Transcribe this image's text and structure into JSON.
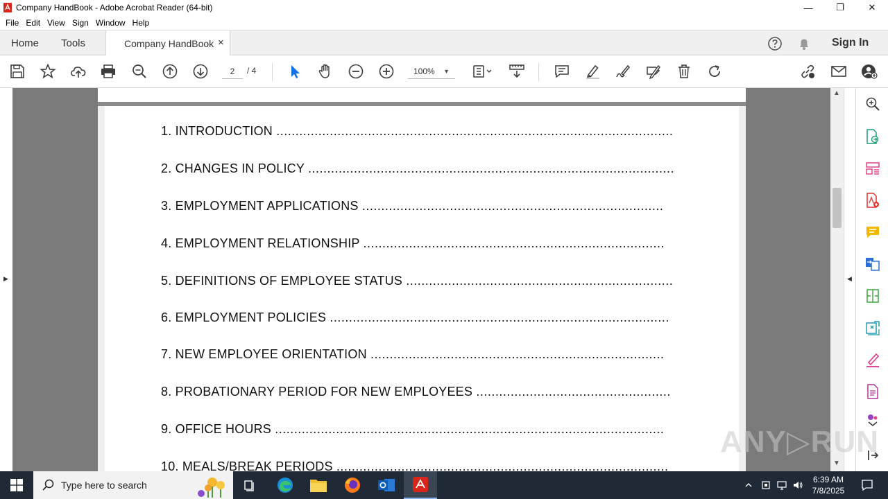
{
  "window": {
    "title": "Company HandBook - Adobe Acrobat Reader (64-bit)",
    "minimize": "—",
    "maximize": "❐",
    "close": "✕"
  },
  "menu": [
    "File",
    "Edit",
    "View",
    "Sign",
    "Window",
    "Help"
  ],
  "tabs": {
    "home": "Home",
    "tools": "Tools",
    "document": "Company HandBook",
    "close_glyph": "×",
    "sign_in": "Sign In"
  },
  "toolbar": {
    "current_page": "2",
    "total_pages": "/ 4",
    "zoom": "100%",
    "zoom_caret": "▼"
  },
  "document": {
    "toc": [
      {
        "label": "1. INTRODUCTION",
        "dots": "........................................................................................................"
      },
      {
        "label": "2. CHANGES IN POLICY",
        "dots": "................................................................................................"
      },
      {
        "label": "3. EMPLOYMENT APPLICATIONS",
        "dots": "..............................................................................."
      },
      {
        "label": "4. EMPLOYMENT RELATIONSHIP",
        "dots": "..............................................................................."
      },
      {
        "label": "5. DEFINITIONS OF EMPLOYEE STATUS",
        "dots": "......................................................................"
      },
      {
        "label": "6. EMPLOYMENT POLICIES",
        "dots": "........................................................................................."
      },
      {
        "label": "7. NEW EMPLOYEE ORIENTATION",
        "dots": "............................................................................."
      },
      {
        "label": "8. PROBATIONARY PERIOD FOR NEW EMPLOYEES",
        "dots": "..................................................."
      },
      {
        "label": "9. OFFICE HOURS",
        "dots": "......................................................................................................"
      },
      {
        "label": "10. MEALS/BREAK PERIODS",
        "dots": "......................................................................................."
      }
    ]
  },
  "scroll": {
    "up": "▲",
    "down": "▼",
    "left_arrow": "▶",
    "right_arrow": "◀"
  },
  "watermark": "ANY▷RUN",
  "taskbar": {
    "search_placeholder": "Type here to search",
    "time": "6:39 AM",
    "date": "7/8/2025"
  },
  "colors": {
    "acrobat_red": "#d9261c",
    "toolbar_icon": "#3c3c3c",
    "select_blue": "#1473e6",
    "taskbar_bg": "#1f2a36"
  }
}
